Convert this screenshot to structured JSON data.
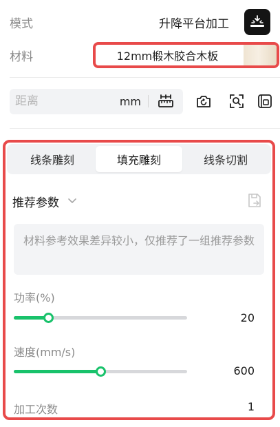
{
  "mode": {
    "label": "模式",
    "value": "升降平台加工",
    "icon": "lift-platform-icon"
  },
  "material": {
    "label": "材料",
    "value": "12mm椴木胶合木板",
    "swatch": "wood-swatch"
  },
  "distance": {
    "placeholder": "距离",
    "unit": "mm"
  },
  "tools": [
    "ruler-measure-icon",
    "camera-refresh-icon",
    "focus-scan-icon",
    "frame-view-icon"
  ],
  "tabs": [
    {
      "label": "线条雕刻",
      "active": false
    },
    {
      "label": "填充雕刻",
      "active": true
    },
    {
      "label": "线条切割",
      "active": false
    }
  ],
  "preset": {
    "label": "推荐参数",
    "note": "材料参考效果差异较小，仅推荐了一组推荐参数"
  },
  "params": {
    "power": {
      "label": "功率(%)",
      "value": "20",
      "fraction": 0.2
    },
    "speed": {
      "label": "速度(mm/s)",
      "value": "600",
      "fraction": 0.5
    },
    "passes": {
      "label": "加工次数",
      "value": "1"
    }
  },
  "colors": {
    "accent": "#19c26b",
    "highlight": "#e84a4a"
  }
}
